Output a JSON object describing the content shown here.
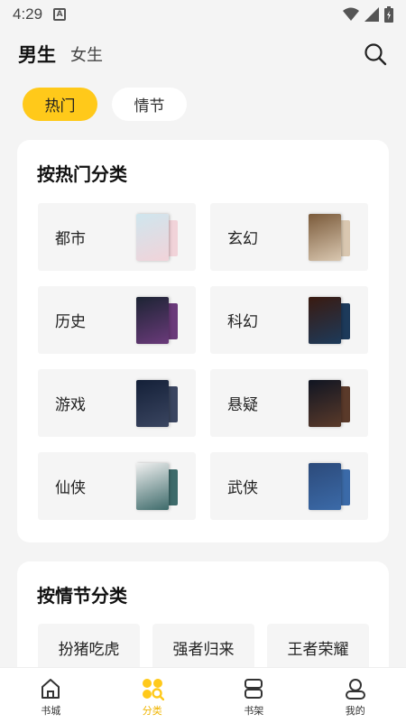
{
  "status_bar": {
    "time": "4:29",
    "notification_icon": "a-icon"
  },
  "header": {
    "tabs": [
      {
        "label": "男生",
        "active": true
      },
      {
        "label": "女生",
        "active": false
      }
    ]
  },
  "pills": [
    {
      "label": "热门",
      "active": true
    },
    {
      "label": "情节",
      "active": false
    }
  ],
  "hot_section": {
    "title": "按热门分类",
    "categories": [
      {
        "label": "都市",
        "cover_colors": [
          "#cfe6ee",
          "#f1d3d9"
        ]
      },
      {
        "label": "玄幻",
        "cover_colors": [
          "#7a5a3a",
          "#d9c7b0"
        ]
      },
      {
        "label": "历史",
        "cover_colors": [
          "#1c2433",
          "#6a3a7a"
        ]
      },
      {
        "label": "科幻",
        "cover_colors": [
          "#3a1a10",
          "#1d3a5a"
        ]
      },
      {
        "label": "游戏",
        "cover_colors": [
          "#142038",
          "#3a4560"
        ]
      },
      {
        "label": "悬疑",
        "cover_colors": [
          "#101522",
          "#5a3a2a"
        ]
      },
      {
        "label": "仙侠",
        "cover_colors": [
          "#f0f0f0",
          "#3d6a6a"
        ]
      },
      {
        "label": "武侠",
        "cover_colors": [
          "#2c4a7a",
          "#3b6aa8"
        ]
      }
    ]
  },
  "plot_section": {
    "title": "按情节分类",
    "tags": [
      "扮猪吃虎",
      "强者归来",
      "王者荣耀"
    ]
  },
  "bottom_nav": [
    {
      "label": "书城",
      "icon": "home-icon",
      "active": false
    },
    {
      "label": "分类",
      "icon": "category-icon",
      "active": true
    },
    {
      "label": "书架",
      "icon": "bookshelf-icon",
      "active": false
    },
    {
      "label": "我的",
      "icon": "profile-icon",
      "active": false
    }
  ],
  "colors": {
    "accent": "#ffc91a",
    "nav_active": "#f0b400",
    "background": "#f4f4f4"
  }
}
